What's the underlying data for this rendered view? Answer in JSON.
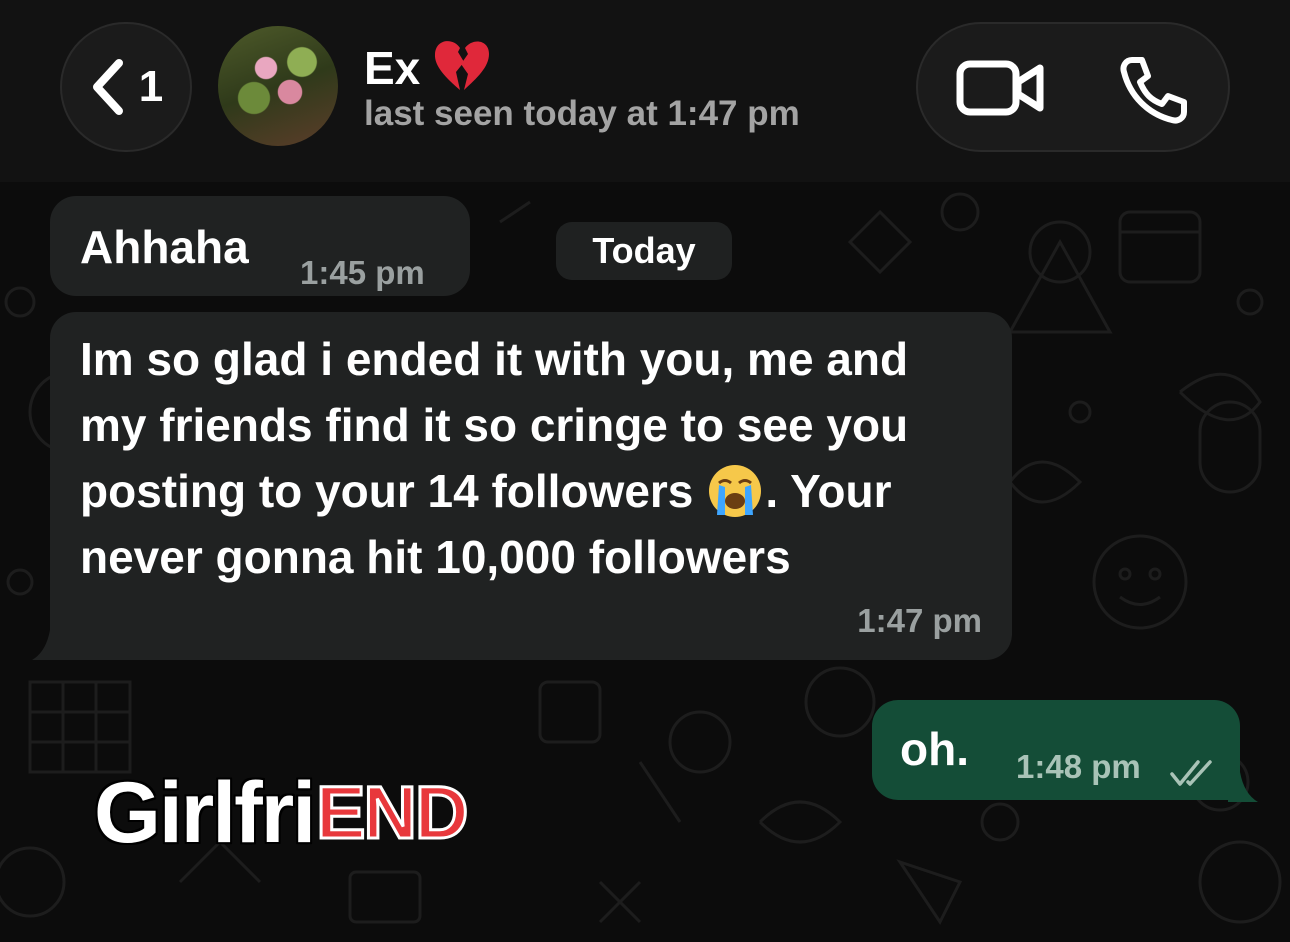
{
  "header": {
    "back_count": "1",
    "contact_name": "Ex",
    "contact_emoji": "broken-heart",
    "last_seen": "last seen today at 1:47 pm",
    "icons": [
      "chevron-left-icon",
      "video-camera-icon",
      "phone-icon"
    ]
  },
  "chat": {
    "date_chip": "Today",
    "messages": [
      {
        "direction": "incoming",
        "text": "Ahhaha",
        "time": "1:45 pm"
      },
      {
        "direction": "incoming",
        "text_lines": [
          "Im so glad i ended it with you, me and",
          "my friends find it so cringe to see you",
          "posting to your 14 followers",
          ". Your",
          "never gonna hit 10,000 followers"
        ],
        "inline_emoji": "loudly-crying-face",
        "time": "1:47 pm"
      },
      {
        "direction": "outgoing",
        "text": "oh.",
        "time": "1:48 pm",
        "status": "read-double-check"
      }
    ]
  },
  "watermark": {
    "part1": "Girlfri",
    "part2": "END"
  },
  "colors": {
    "header_bg": "#121212",
    "incoming_bubble": "#202222",
    "outgoing_bubble": "#144d37",
    "watermark_red": "#e8383c"
  }
}
